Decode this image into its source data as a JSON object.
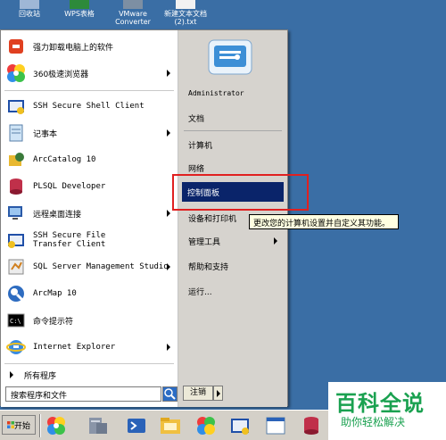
{
  "desktop": {
    "icons": [
      {
        "label": "回收站"
      },
      {
        "label": "WPS表格"
      },
      {
        "label": "VMware Converter"
      },
      {
        "label": "新建文本文档 (2).txt"
      }
    ]
  },
  "start_menu": {
    "programs": [
      {
        "label": "强力卸载电脑上的软件",
        "icon": "uninstall-icon",
        "submenu": false
      },
      {
        "label": "360极速浏览器",
        "icon": "browser-360-icon",
        "submenu": true
      },
      {
        "label": "SSH Secure Shell Client",
        "icon": "ssh-shell-icon",
        "submenu": false
      },
      {
        "label": "记事本",
        "icon": "notepad-icon",
        "submenu": true
      },
      {
        "label": "ArcCatalog 10",
        "icon": "arccatalog-icon",
        "submenu": false
      },
      {
        "label": "PLSQL Developer",
        "icon": "plsql-icon",
        "submenu": false
      },
      {
        "label": "远程桌面连接",
        "icon": "remote-desktop-icon",
        "submenu": true
      },
      {
        "label": "SSH Secure File Transfer Client",
        "icon": "ssh-file-transfer-icon",
        "submenu": false
      },
      {
        "label": "SQL Server Management Studio",
        "icon": "sql-server-icon",
        "submenu": true
      },
      {
        "label": "ArcMap 10",
        "icon": "arcmap-icon",
        "submenu": false
      },
      {
        "label": "命令提示符",
        "icon": "cmd-icon",
        "submenu": false
      },
      {
        "label": "Internet Explorer",
        "icon": "ie-icon",
        "submenu": true
      }
    ],
    "all_programs": "所有程序",
    "search_placeholder": "搜索程序和文件",
    "right_items": {
      "user": "Administrator",
      "documents": "文档",
      "computer": "计算机",
      "network": "网络",
      "control_panel": "控制面板",
      "devices": "设备和打印机",
      "admin_tools": "管理工具",
      "help": "帮助和支持",
      "run": "运行..."
    },
    "tooltip": "更改您的计算机设置并自定义其功能。",
    "logout": "注销"
  },
  "taskbar": {
    "start_label": "开始"
  },
  "watermark": {
    "title": "百科全说",
    "subtitle": "助你轻松解决"
  },
  "colors": {
    "desktop": "#3a6ea5",
    "highlight": "#0a246a",
    "red_box": "#e02020",
    "tooltip_bg": "#ffffe1",
    "watermark_green": "#1aa150"
  }
}
